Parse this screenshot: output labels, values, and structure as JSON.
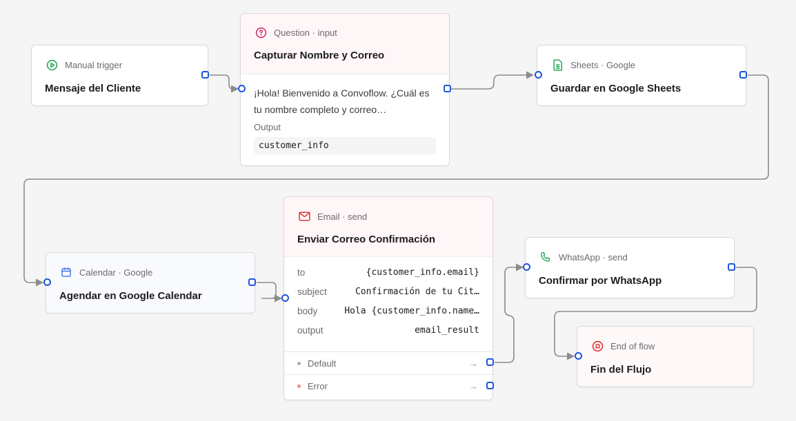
{
  "colors": {
    "port": "#1a56db",
    "edge": "#8c8c8c",
    "trigger": "#16a34a",
    "question": "#d1236b",
    "sheets": "#16a34a",
    "calendar": "#2563eb",
    "email": "#dc2626",
    "whatsapp": "#16a34a",
    "end": "#dc2626"
  },
  "nodes": {
    "trigger": {
      "subtitle": "Manual trigger",
      "title": "Mensaje del Cliente",
      "icon": "play-circle-icon"
    },
    "question": {
      "subtitle": "Question · input",
      "title": "Capturar Nombre y Correo",
      "icon": "question-circle-icon",
      "body": "¡Hola! Bienvenido a Convoflow. ¿Cuál es tu nombre completo y correo…",
      "output_label": "Output",
      "output_value": "customer_info"
    },
    "sheets": {
      "subtitle": "Sheets · Google",
      "title": "Guardar en Google Sheets",
      "icon": "spreadsheet-icon"
    },
    "calendar": {
      "subtitle": "Calendar · Google",
      "title": "Agendar en Google Calendar",
      "icon": "calendar-icon"
    },
    "email": {
      "subtitle": "Email · send",
      "title": "Enviar Correo Confirmación",
      "icon": "mail-icon",
      "fields": [
        {
          "key": "to",
          "value": "{customer_info.email}"
        },
        {
          "key": "subject",
          "value": "Confirmación de tu Cit…"
        },
        {
          "key": "body",
          "value": "Hola {customer_info.name…"
        },
        {
          "key": "output",
          "value": "email_result"
        }
      ],
      "branches": [
        {
          "label": "Default"
        },
        {
          "label": "Error"
        }
      ]
    },
    "whatsapp": {
      "subtitle": "WhatsApp · send",
      "title": "Confirmar por WhatsApp",
      "icon": "phone-icon"
    },
    "end": {
      "subtitle": "End of flow",
      "title": "Fin del Flujo",
      "icon": "stop-circle-icon"
    }
  }
}
